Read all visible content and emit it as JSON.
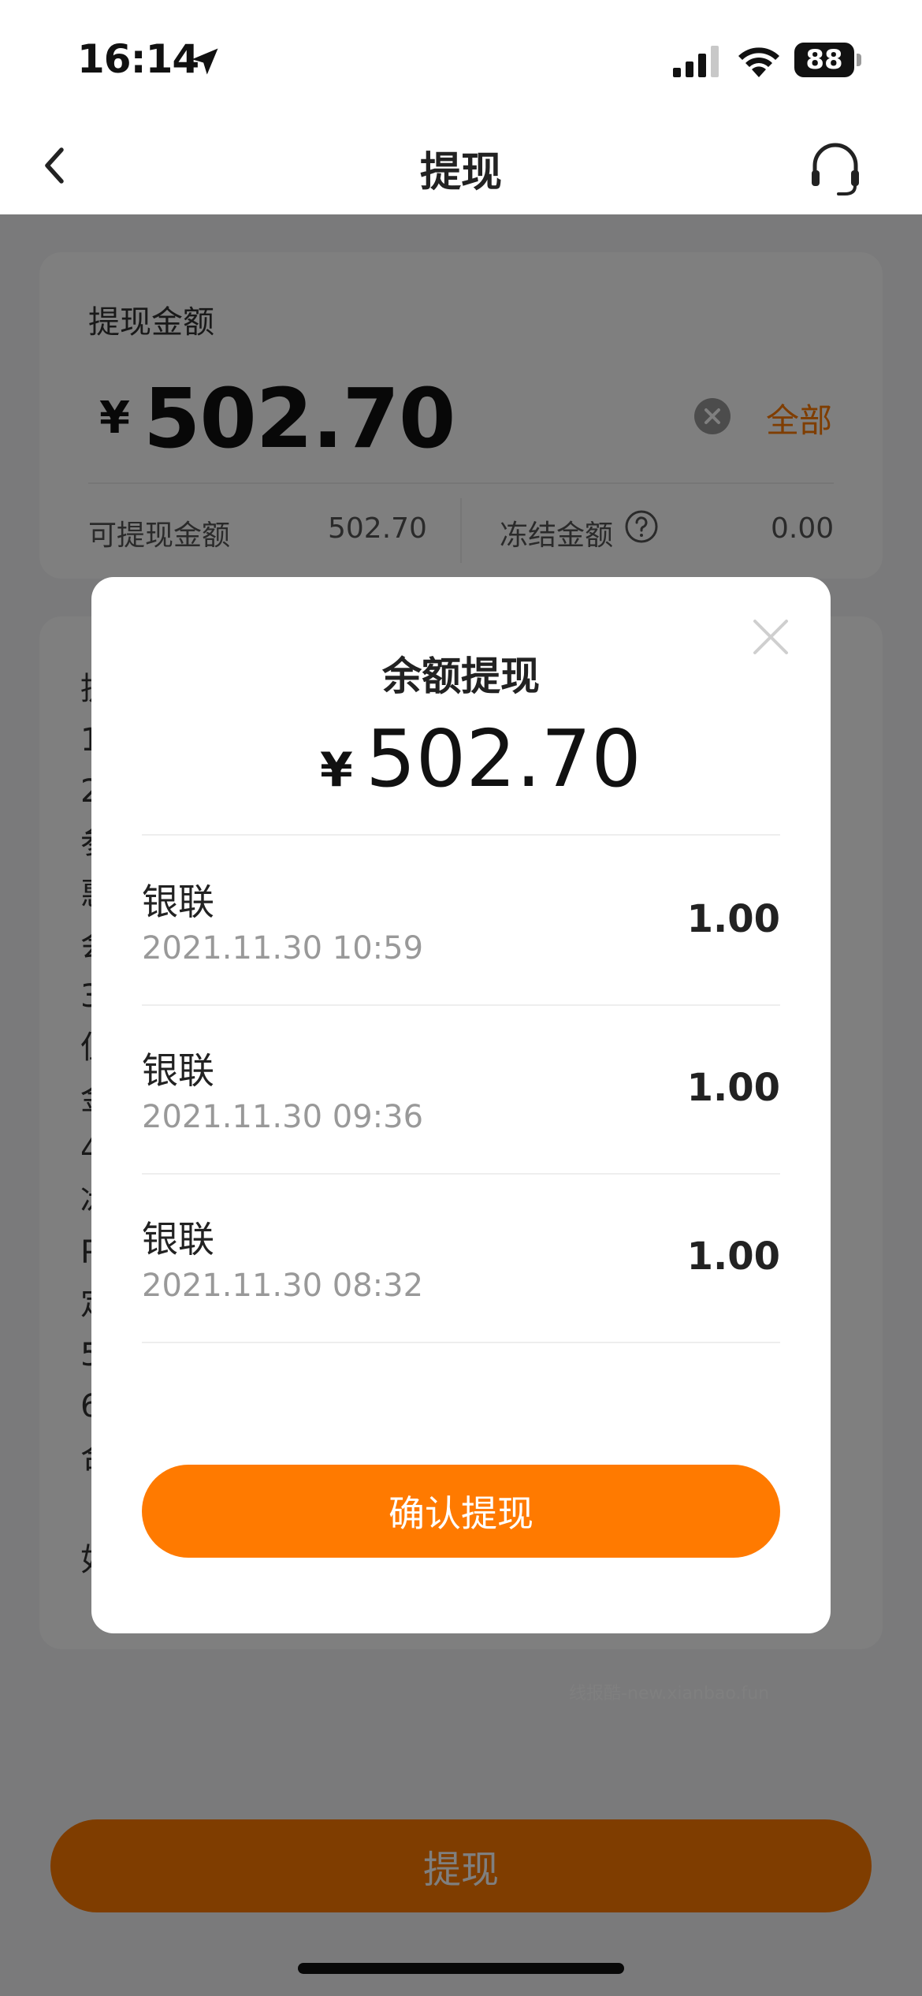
{
  "status_bar": {
    "time": "16:14",
    "battery": "88"
  },
  "nav": {
    "title": "提现"
  },
  "amount_card": {
    "label": "提现金额",
    "currency": "¥",
    "value": "502.70",
    "all_label": "全部",
    "available_label": "可提现金额",
    "available_value": "502.70",
    "frozen_label": "冻结金额",
    "frozen_value": "0.00"
  },
  "rules_card": {
    "visible_text": "提\n1\n2\n参\n惠\n会\n3\n但\n金\n4\n冰\nP\n定\n5\n6\n合\n\n如"
  },
  "watermark": "线报酷-new.xianbao.fun",
  "withdraw_button": "提现",
  "dialog": {
    "title": "余额提现",
    "currency": "¥",
    "amount": "502.70",
    "items": [
      {
        "name": "银联",
        "time": "2021.11.30 10:59",
        "amount": "1.00"
      },
      {
        "name": "银联",
        "time": "2021.11.30 09:36",
        "amount": "1.00"
      },
      {
        "name": "银联",
        "time": "2021.11.30 08:32",
        "amount": "1.00"
      }
    ],
    "confirm_label": "确认提现"
  },
  "colors": {
    "accent": "#ff7a00",
    "overlay": "rgba(0,0,0,0.5)"
  }
}
